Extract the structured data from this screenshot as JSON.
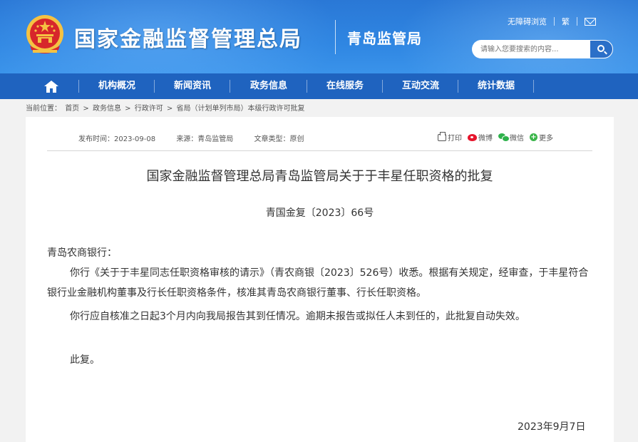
{
  "header": {
    "site_title": "国家金融监督管理总局",
    "sub_title": "青岛监管局",
    "links": {
      "accessibility": "无障碍浏览",
      "traditional": "繁"
    },
    "search_placeholder": "请输入您要搜索的内容...",
    "colors": {
      "header_blue": "#2f86e2",
      "nav_blue": "#1f63bf",
      "emblem_red": "#d7262b",
      "emblem_gold": "#f5c242"
    }
  },
  "nav": {
    "home_icon": "home-icon",
    "items": [
      {
        "label": "机构概况"
      },
      {
        "label": "新闻资讯"
      },
      {
        "label": "政务信息"
      },
      {
        "label": "在线服务"
      },
      {
        "label": "互动交流"
      },
      {
        "label": "统计数据"
      }
    ]
  },
  "breadcrumb": {
    "label": "当前位置：",
    "items": [
      "首页",
      "政务信息",
      "行政许可",
      "省局（计划单列市局）本级行政许可批复"
    ],
    "separator": ">"
  },
  "article": {
    "meta": {
      "publish_time": "发布时间：2023-09-08",
      "source": "来源：青岛监管局",
      "doc_type": "文章类型：原创"
    },
    "share": {
      "print": "打印",
      "weibo": "微博",
      "wechat": "微信",
      "more": "更多"
    },
    "title": "国家金融监督管理总局青岛监管局关于于丰星任职资格的批复",
    "doc_number": "青国金复〔2023〕66号",
    "addressee": "青岛农商银行：",
    "para1": "你行《关于于丰星同志任职资格审核的请示》（青农商银〔2023〕526号）收悉。根据有关规定，经审查，于丰星符合银行业金融机构董事及行长任职资格条件，核准其青岛农商银行董事、行长任职资格。",
    "para2": "你行应自核准之日起3个月内向我局报告其到任情况。逾期未报告或拟任人未到任的，此批复自动失效。",
    "closing": "此复。",
    "date": "2023年9月7日"
  }
}
